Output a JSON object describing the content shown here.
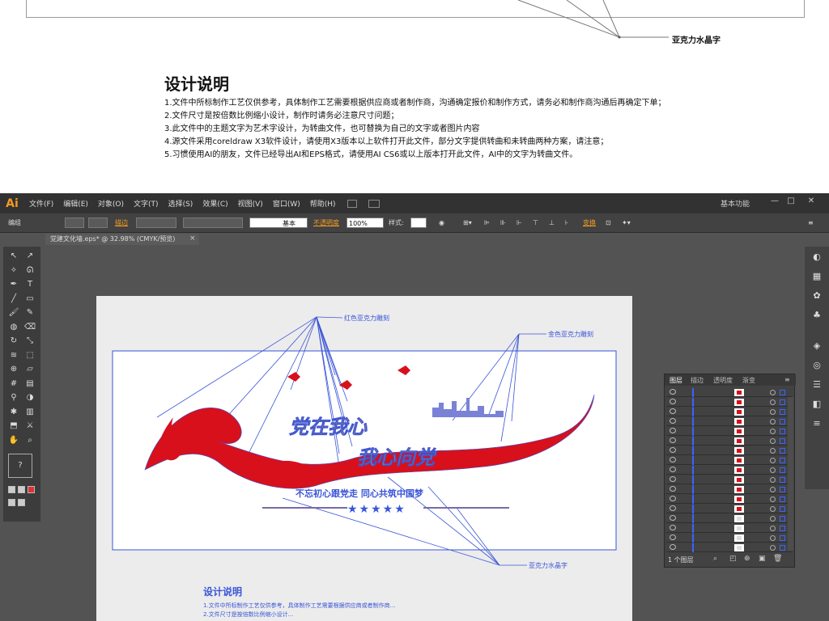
{
  "sheet": {
    "callout_label": "亚克力水晶字",
    "title": "设计说明",
    "notes": [
      "1.文件中所标制作工艺仅供参考，具体制作工艺需要根据供应商或者制作商，沟通确定报价和制作方式，请务必和制作商沟通后再确定下单；",
      "2.文件尺寸是按倍数比例缩小设计，制作时请务必注意尺寸问题；",
      "3.此文件中的主题文字为艺术字设计，为转曲文件，也可替换为自己的文字或者图片内容",
      "4.源文件采用coreldraw X3软件设计，请使用X3版本以上软件打开此文件，部分文字提供转曲和未转曲两种方案，请注意；",
      "5.习惯使用AI的朋友，文件已经导出AI和EPS格式，请使用AI CS6或以上版本打开此文件，AI中的文字为转曲文件。"
    ]
  },
  "app": {
    "logo": "Ai",
    "menus": [
      "文件(F)",
      "编辑(E)",
      "对象(O)",
      "文字(T)",
      "选择(S)",
      "效果(C)",
      "视图(V)",
      "窗口(W)",
      "帮助(H)"
    ],
    "workspace": "基本功能",
    "window_controls": [
      "—",
      "□",
      "✕"
    ]
  },
  "control_bar": {
    "group_label": "编组",
    "stroke_label": "描边",
    "stroke_style": "基本",
    "opacity_label": "不透明度",
    "opacity_value": "100%",
    "style_label": "样式:",
    "transform_label": "变换"
  },
  "document": {
    "tab_title": "党建文化墙.eps* @ 32.98% (CMYK/预览)"
  },
  "toolbar": {
    "icons": [
      "selection-icon",
      "direct-selection-icon",
      "magic-wand-icon",
      "lasso-icon",
      "pen-icon",
      "type-icon",
      "line-icon",
      "rectangle-icon",
      "paintbrush-icon",
      "pencil-icon",
      "blob-brush-icon",
      "eraser-icon",
      "rotate-icon",
      "scale-icon",
      "warp-icon",
      "free-transform-icon",
      "shape-builder-icon",
      "perspective-icon",
      "mesh-icon",
      "gradient-icon",
      "eyedropper-icon",
      "blend-icon",
      "symbol-sprayer-icon",
      "graph-icon",
      "artboard-icon",
      "slice-icon",
      "hand-icon",
      "zoom-icon"
    ],
    "fill_stroke": "?"
  },
  "right_strip": {
    "icons": [
      "color-icon",
      "swatches-icon",
      "brushes-icon",
      "symbols-icon",
      "graphic-styles-icon",
      "appearance-icon",
      "align-icon",
      "transparency-icon",
      "stroke-icon"
    ]
  },
  "artwork": {
    "headline_1": "党在我心",
    "headline_2": "我心向党",
    "slogan": "不忘初心跟党走 同心共筑中国梦",
    "stars": "★★★★★",
    "labels": [
      "红色亚克力雕刻",
      "金色亚克力雕刻",
      "亚克力水晶字"
    ],
    "colors": {
      "red": "#d7101c",
      "gold": "#e09b2a",
      "guide": "#3a55d8",
      "artboard": "#ececec",
      "panel": "#535353"
    }
  },
  "artboard_notes": {
    "title": "设计说明",
    "lines": [
      "1.文件中所标制作工艺仅供参考，具体制作工艺需要根据供应商或者制作商…",
      "2.文件尺寸是按倍数比例缩小设计…"
    ]
  },
  "layers_panel": {
    "tabs": [
      "图层",
      "描边",
      "透明度",
      "渐变"
    ],
    "row_count": 17,
    "footer": "1 个图层"
  }
}
